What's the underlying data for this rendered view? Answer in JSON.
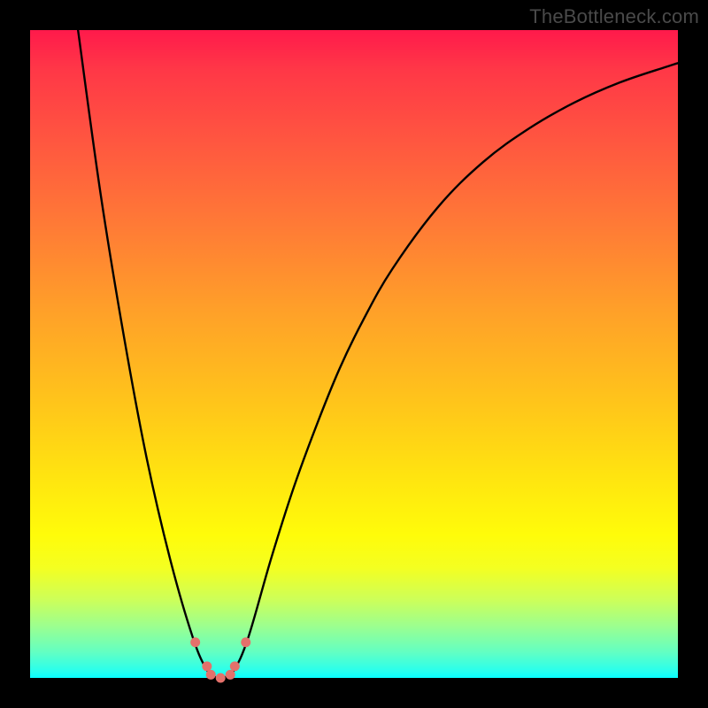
{
  "watermark": "TheBottleneck.com",
  "colors": {
    "frame": "#000000",
    "curve": "#000000",
    "dots": "#e4716b"
  },
  "chart_data": {
    "type": "line",
    "title": "",
    "xlabel": "",
    "ylabel": "",
    "xlim": [
      0,
      100
    ],
    "ylim": [
      0,
      100
    ],
    "note": "No visible axis ticks or numeric labels; x/y units are relative (0–100) estimated from pixel positions.",
    "series": [
      {
        "name": "curve-left",
        "x": [
          7.4,
          10.9,
          14.5,
          18.0,
          21.6,
          25.1,
          27.3,
          28.7,
          29.4
        ],
        "y": [
          100.0,
          74.6,
          52.6,
          33.9,
          18.4,
          6.3,
          1.2,
          0.1,
          0.0
        ]
      },
      {
        "name": "curve-right",
        "x": [
          29.4,
          30.1,
          31.5,
          33.7,
          37.2,
          40.7,
          44.3,
          47.8,
          51.4,
          55.9,
          62.9,
          69.9,
          77.0,
          84.0,
          91.0,
          98.1,
          100.0
        ],
        "y": [
          0.0,
          0.1,
          1.2,
          6.3,
          18.4,
          29.4,
          39.2,
          47.8,
          55.2,
          63.1,
          72.6,
          79.6,
          84.8,
          88.8,
          91.9,
          94.3,
          94.9
        ]
      }
    ],
    "dots": [
      {
        "x": 25.5,
        "y": 5.5
      },
      {
        "x": 27.3,
        "y": 1.8
      },
      {
        "x": 27.9,
        "y": 0.5
      },
      {
        "x": 29.4,
        "y": 0.0
      },
      {
        "x": 30.9,
        "y": 0.5
      },
      {
        "x": 31.6,
        "y": 1.8
      },
      {
        "x": 33.3,
        "y": 5.5
      }
    ],
    "background_gradient": {
      "orientation": "vertical",
      "stops": [
        {
          "pos": 0.0,
          "color": "#ff1a4b"
        },
        {
          "pos": 0.5,
          "color": "#ffb020"
        },
        {
          "pos": 0.8,
          "color": "#fffc0a"
        },
        {
          "pos": 1.0,
          "color": "#09ffff"
        }
      ]
    }
  }
}
